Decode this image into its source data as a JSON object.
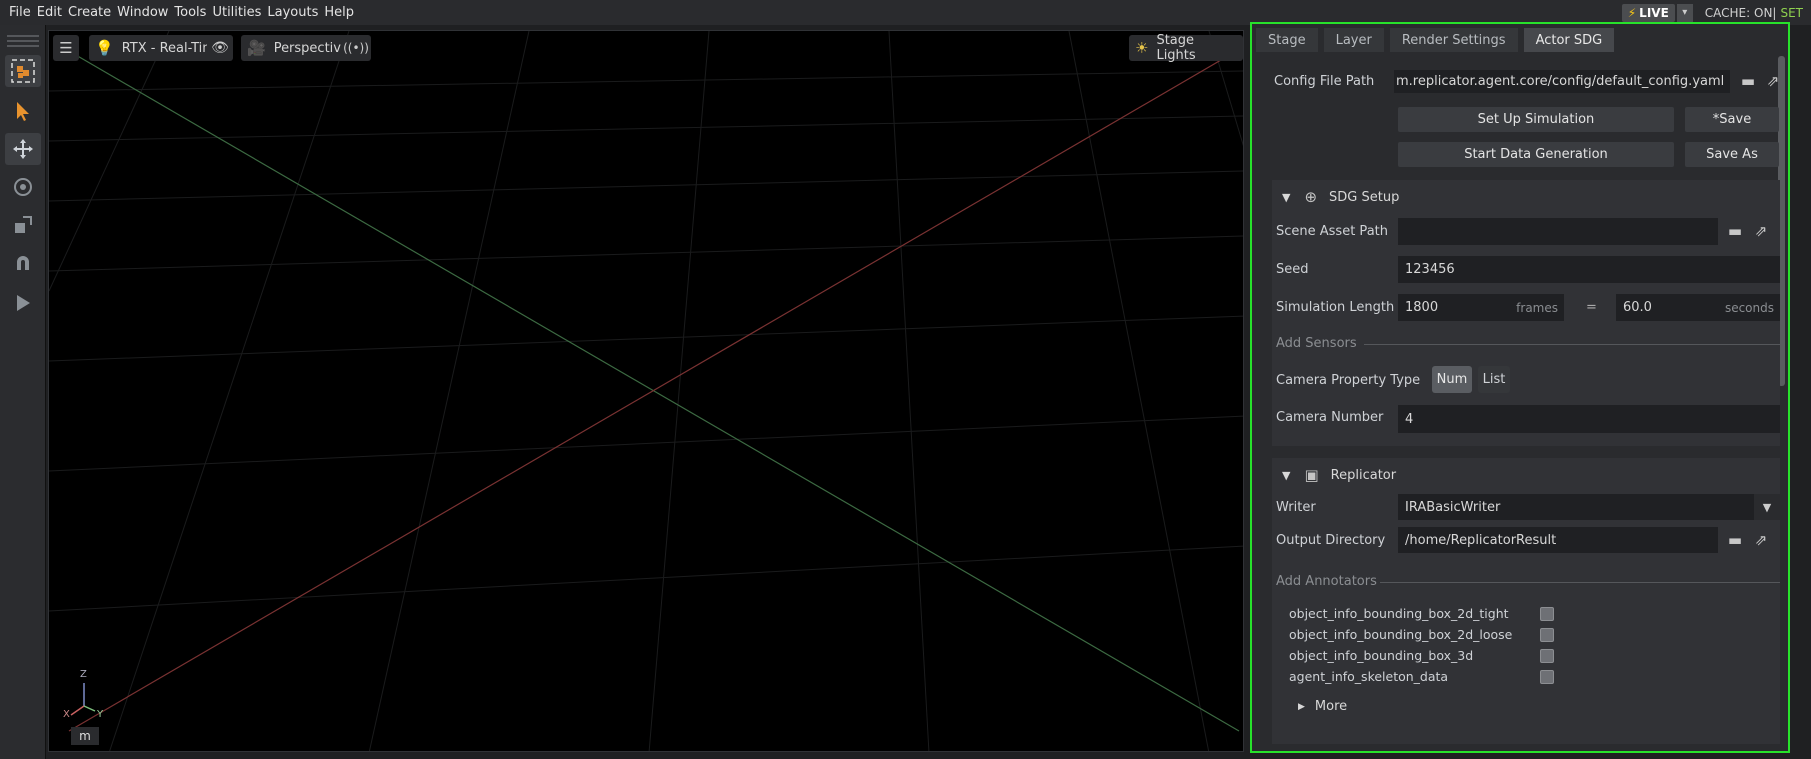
{
  "menubar": {
    "items": [
      "File",
      "Edit",
      "Create",
      "Window",
      "Tools",
      "Utilities",
      "Layouts",
      "Help"
    ],
    "live_label": "LIVE",
    "cache_label": "CACHE: ON|",
    "set_label": "SET"
  },
  "viewport": {
    "settings_icon": "sliders-icon",
    "render_mode": "RTX - Real-Time",
    "camera": "Perspective",
    "lights": "Stage Lights",
    "unit_label": "m",
    "axis_labels": {
      "z": "Z",
      "x": "X",
      "y": "Y"
    }
  },
  "tabs": [
    {
      "label": "Stage",
      "active": false
    },
    {
      "label": "Layer",
      "active": false
    },
    {
      "label": "Render Settings",
      "active": false
    },
    {
      "label": "Actor SDG",
      "active": true
    }
  ],
  "config": {
    "label": "Config File Path",
    "value": "m.replicator.agent.core/config/default_config.yaml",
    "setup_button": "Set Up Simulation",
    "save_button": "*Save",
    "start_button": "Start Data Generation",
    "save_as_button": "Save As"
  },
  "sdg_setup": {
    "title": "SDG Setup",
    "scene_asset_path_label": "Scene Asset Path",
    "scene_asset_path_value": "",
    "seed_label": "Seed",
    "seed_value": "123456",
    "sim_length_label": "Simulation Length",
    "frames_value": "1800",
    "frames_unit": "frames",
    "equals": "=",
    "seconds_value": "60.0",
    "seconds_unit": "seconds",
    "add_sensors_label": "Add Sensors",
    "camera_property_type_label": "Camera Property Type",
    "toggle_num": "Num",
    "toggle_list": "List",
    "camera_number_label": "Camera Number",
    "camera_number_value": "4"
  },
  "replicator": {
    "title": "Replicator",
    "writer_label": "Writer",
    "writer_value": "IRABasicWriter",
    "output_dir_label": "Output Directory",
    "output_dir_value": "/home/ReplicatorResult",
    "add_annotators_label": "Add Annotators",
    "annotators": [
      "object_info_bounding_box_2d_tight",
      "object_info_bounding_box_2d_loose",
      "object_info_bounding_box_3d",
      "agent_info_skeleton_data"
    ],
    "more_label": "More"
  },
  "colors": {
    "highlight_border": "#27e22b",
    "set_text": "#8fd14f",
    "live_bolt": "#f5c518"
  }
}
